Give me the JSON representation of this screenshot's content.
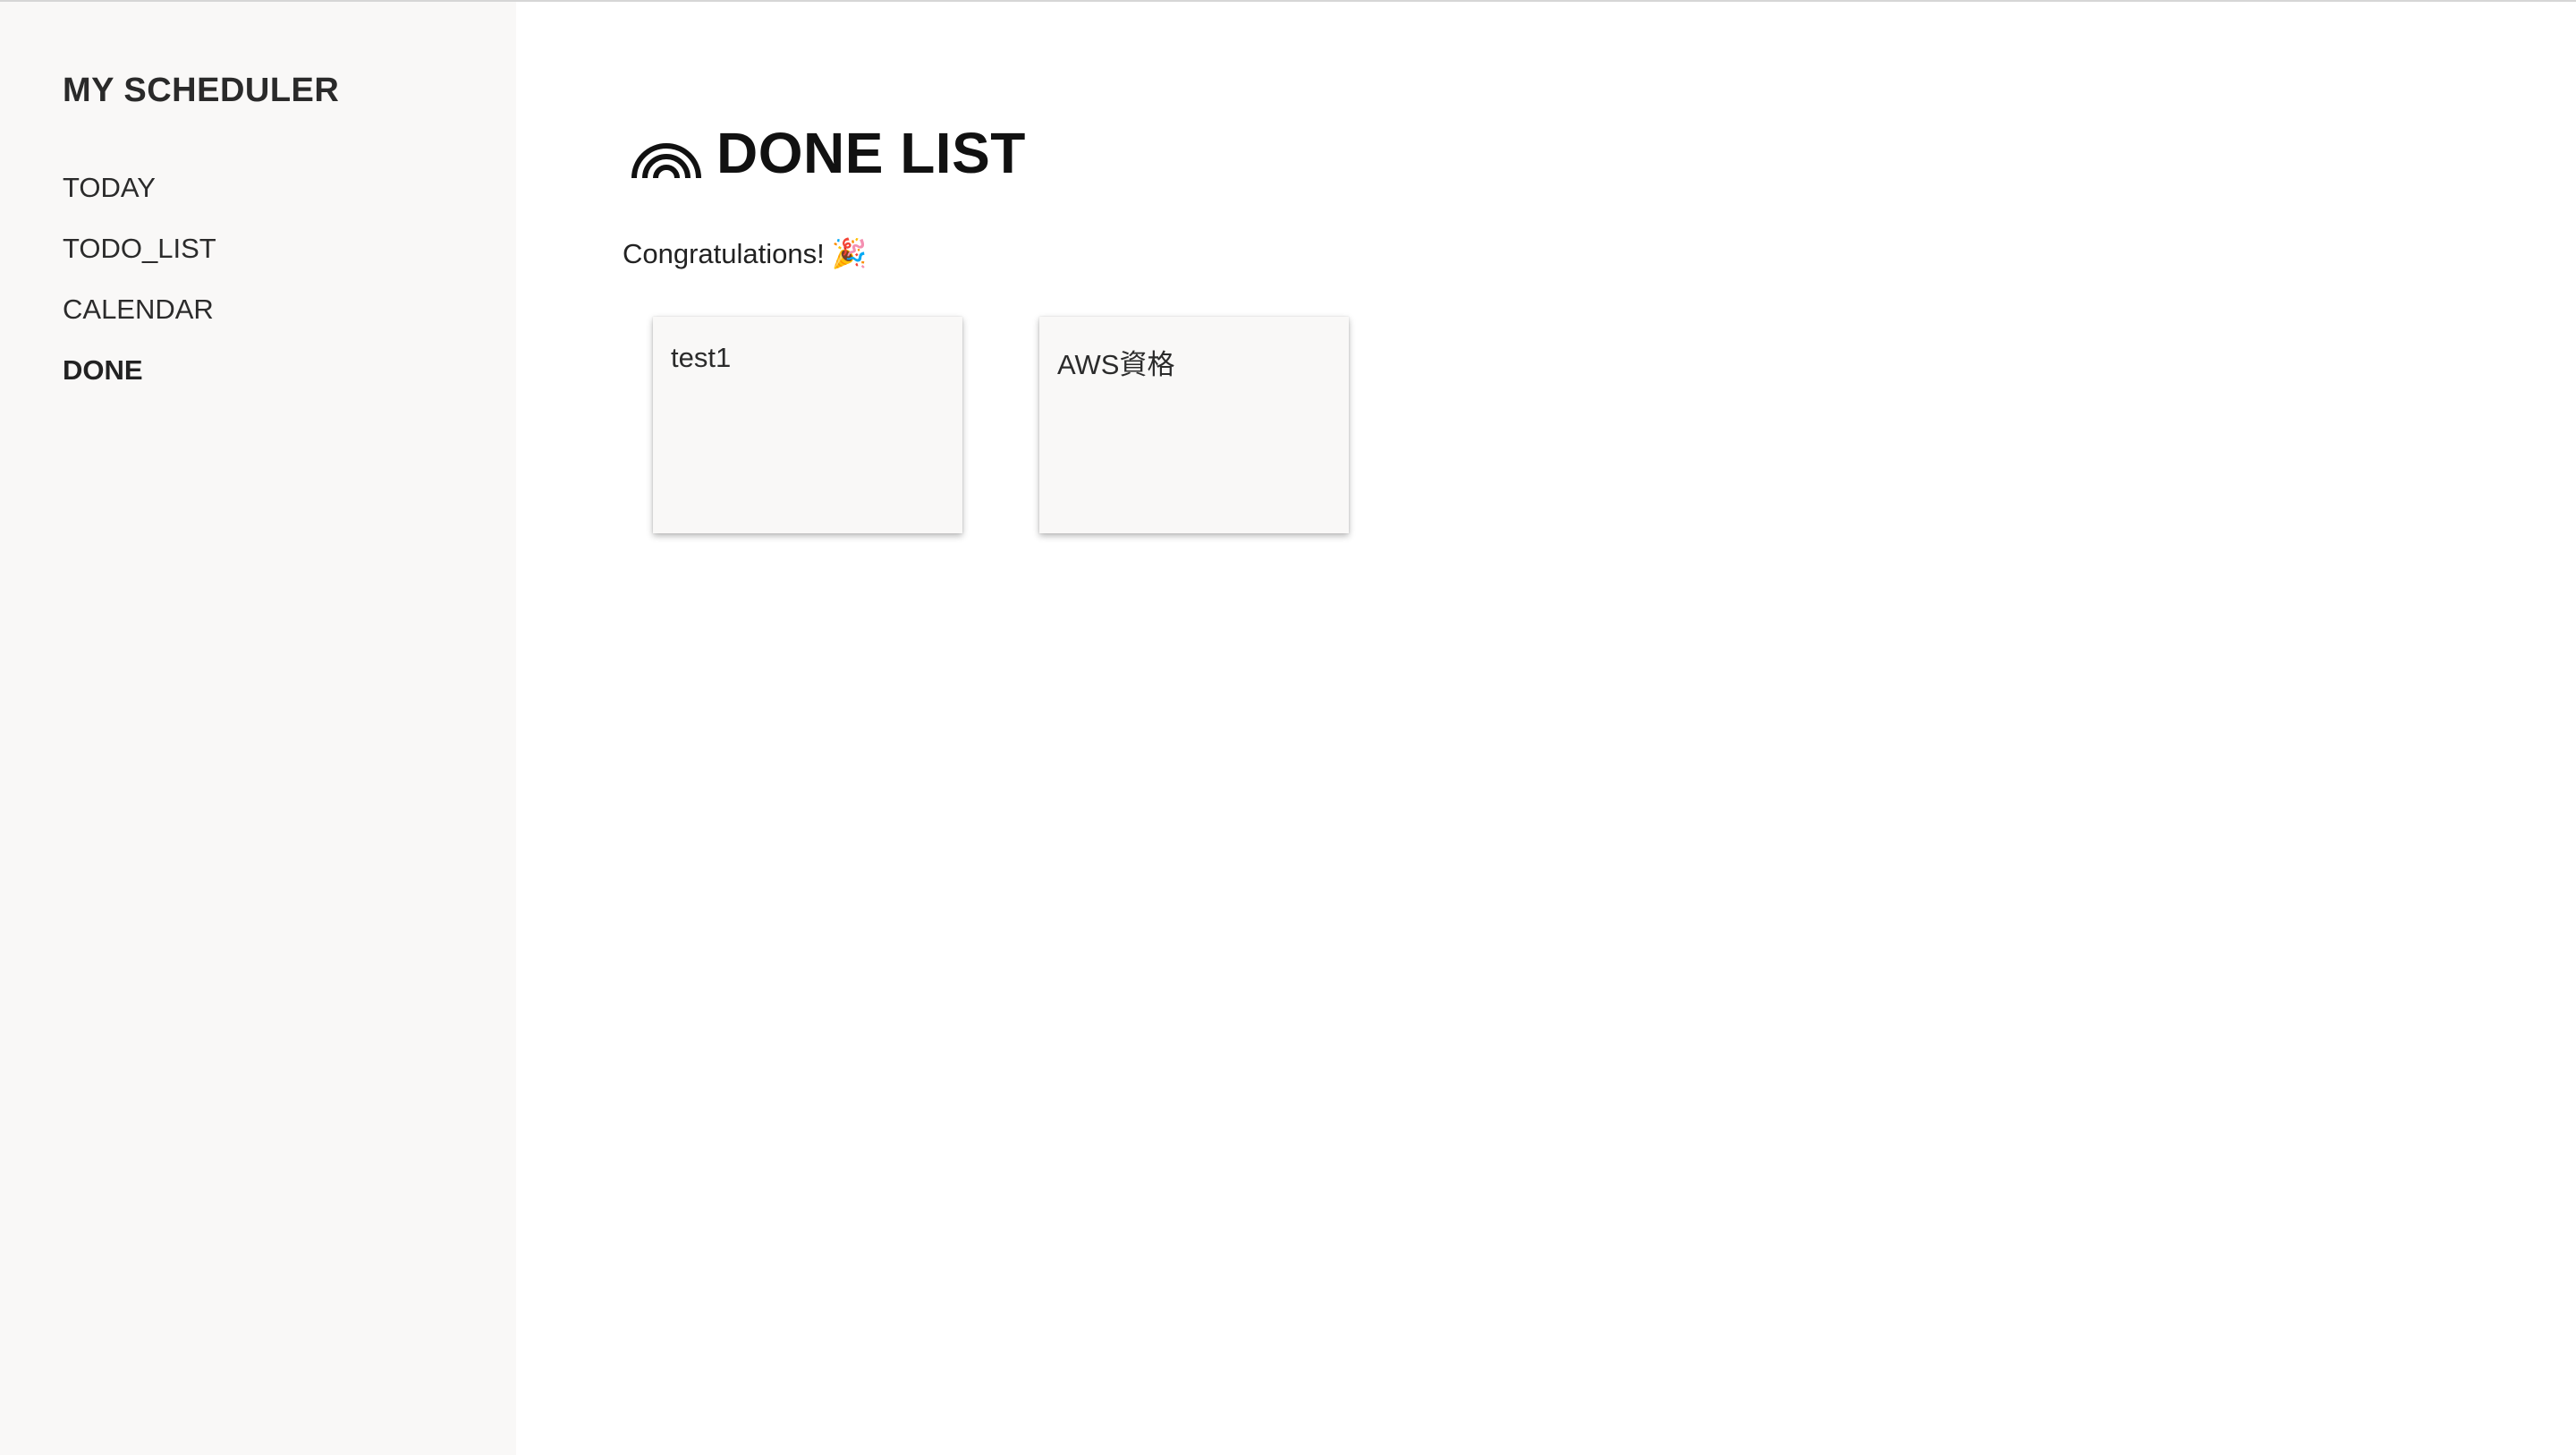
{
  "sidebar": {
    "brand": "MY SCHEDULER",
    "items": [
      {
        "label": "TODAY",
        "active": false
      },
      {
        "label": "TODO_LIST",
        "active": false
      },
      {
        "label": "CALENDAR",
        "active": false
      },
      {
        "label": "DONE",
        "active": true
      }
    ]
  },
  "main": {
    "title_icon": "rainbow-icon",
    "title": "DONE LIST",
    "subtitle": "Congratulations!",
    "subtitle_emoji": "🎉",
    "cards": [
      {
        "title": "test1"
      },
      {
        "title": "AWS資格"
      }
    ]
  },
  "colors": {
    "sidebar_bg": "#f9f8f7",
    "card_bg": "#f9f8f7",
    "text": "#222222"
  }
}
